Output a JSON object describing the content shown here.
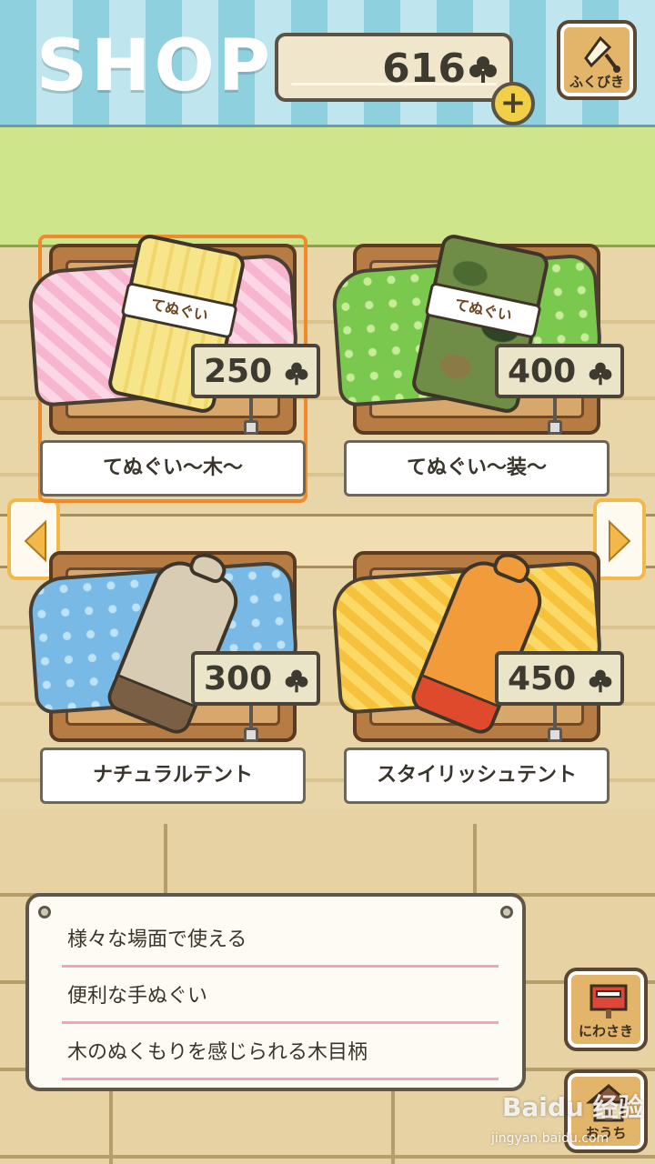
{
  "header": {
    "title": "SHOP",
    "clover_balance": "616",
    "plus_label": "+",
    "fukubiki_label": "ふくびき"
  },
  "items": [
    {
      "name": "てぬぐい～木～",
      "price": "250",
      "band_text": "てぬぐい",
      "selected": true
    },
    {
      "name": "てぬぐい～装～",
      "price": "400",
      "band_text": "てぬぐい",
      "selected": false
    },
    {
      "name": "ナチュラルテント",
      "price": "300",
      "selected": false
    },
    {
      "name": "スタイリッシュテント",
      "price": "450",
      "selected": false
    }
  ],
  "description": {
    "lines": [
      "様々な場面で使える",
      "便利な手ぬぐい",
      "木のぬくもりを感じられる木目柄"
    ]
  },
  "side_buttons": {
    "niwasaki_label": "にわさき",
    "house_label": "おうち"
  },
  "watermark": {
    "brand": "Baidu 经验",
    "url": "jingyan.baidu.com"
  },
  "colors": {
    "selection": "#f08a2c",
    "awning_dark": "#8fd0df",
    "awning_light": "#bfe6ee",
    "grass": "#cfe58c",
    "coin_yellow": "#f1cf47"
  }
}
